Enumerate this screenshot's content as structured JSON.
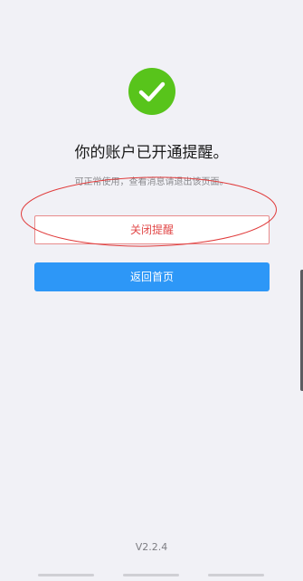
{
  "status": {
    "icon": "check-circle-icon",
    "icon_color": "#58c41b",
    "title": "你的账户已开通提醒。",
    "subtitle": "可正常使用，查看消息请退出该页面。"
  },
  "actions": {
    "close_reminder_label": "关闭提醒",
    "close_reminder_color": "#e24a4a",
    "back_home_label": "返回首页",
    "back_home_color": "#2d97f7"
  },
  "annotation": {
    "shape": "ellipse",
    "color": "#e03b3b"
  },
  "footer": {
    "version": "V2.2.4"
  }
}
